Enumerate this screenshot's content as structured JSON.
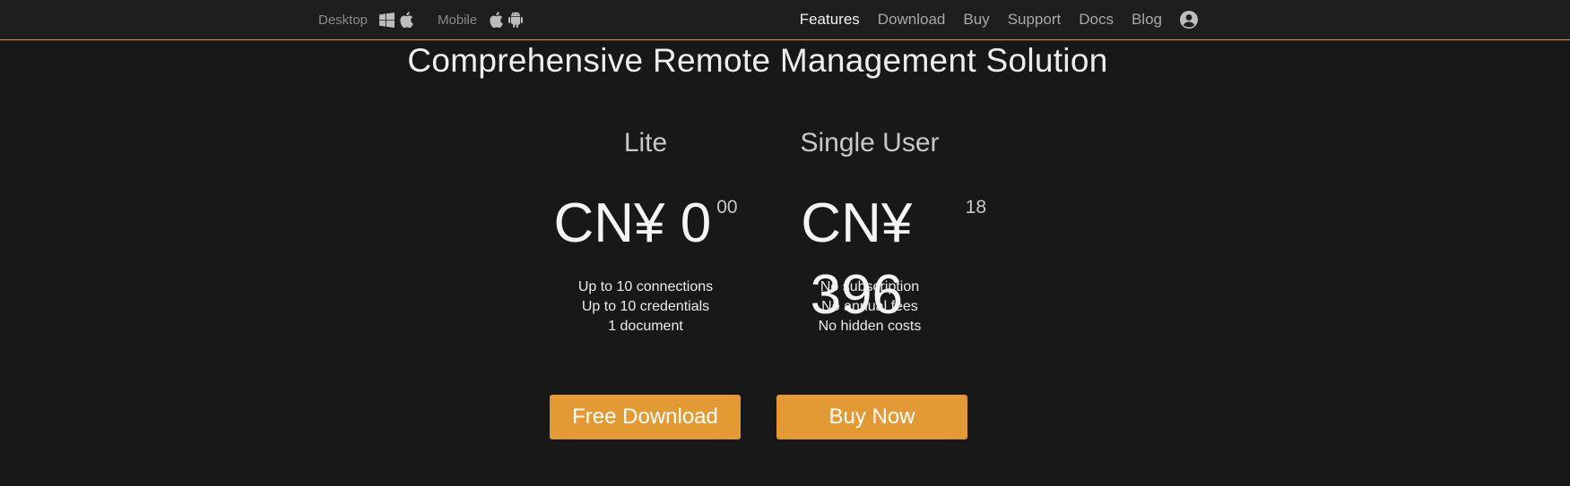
{
  "header": {
    "platforms": {
      "desktop_label": "Desktop",
      "mobile_label": "Mobile"
    },
    "nav": [
      {
        "label": "Features",
        "active": true
      },
      {
        "label": "Download",
        "active": false
      },
      {
        "label": "Buy",
        "active": false
      },
      {
        "label": "Support",
        "active": false
      },
      {
        "label": "Docs",
        "active": false
      },
      {
        "label": "Blog",
        "active": false
      }
    ],
    "icons": [
      "windows-icon",
      "apple-icon",
      "apple-icon",
      "android-icon",
      "user-account-icon"
    ]
  },
  "hero": {
    "title": "Comprehensive Remote Management Solution"
  },
  "plans": [
    {
      "name": "Lite",
      "price_main": "CN¥ 0",
      "price_cents": "00",
      "features": [
        "Up to 10 connections",
        "Up to 10 credentials",
        "1 document"
      ]
    },
    {
      "name": "Single User",
      "price_main": "CN¥ 396",
      "price_cents": "18",
      "features": [
        "No subscription",
        "No annual fees",
        "No hidden costs"
      ]
    }
  ],
  "buttons": {
    "free_download": "Free Download",
    "buy_now": "Buy Now"
  },
  "colors": {
    "accent": "#e39a35",
    "background": "#181818",
    "topbar": "#1e1e1e"
  }
}
